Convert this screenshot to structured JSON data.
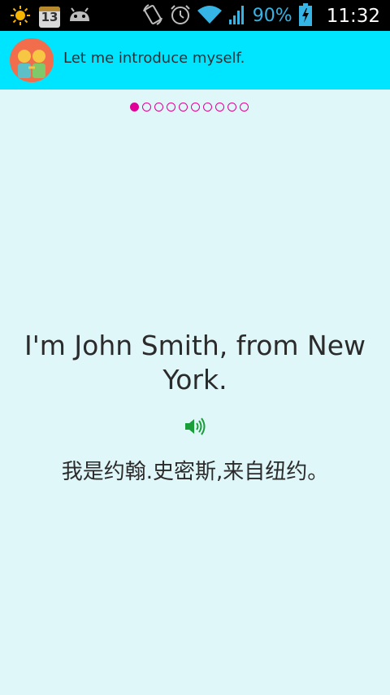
{
  "status_bar": {
    "calendar_day": "13",
    "battery_percent": "90%",
    "time": "11:32",
    "icons": [
      "weather-sun-icon",
      "calendar-icon",
      "android-icon",
      "rotate-icon",
      "alarm-icon",
      "wifi-icon",
      "signal-icon",
      "battery-charging-icon"
    ]
  },
  "header": {
    "title": "Let me introduce myself.",
    "background": "#00e5ff"
  },
  "pager": {
    "total": 10,
    "current": 1,
    "accent": "#e10098"
  },
  "content": {
    "english": "I'm John Smith, from New York.",
    "chinese": "我是约翰.史密斯,来自纽约。",
    "audio_icon": "speaker-icon",
    "audio_color": "#1a9e3a"
  }
}
